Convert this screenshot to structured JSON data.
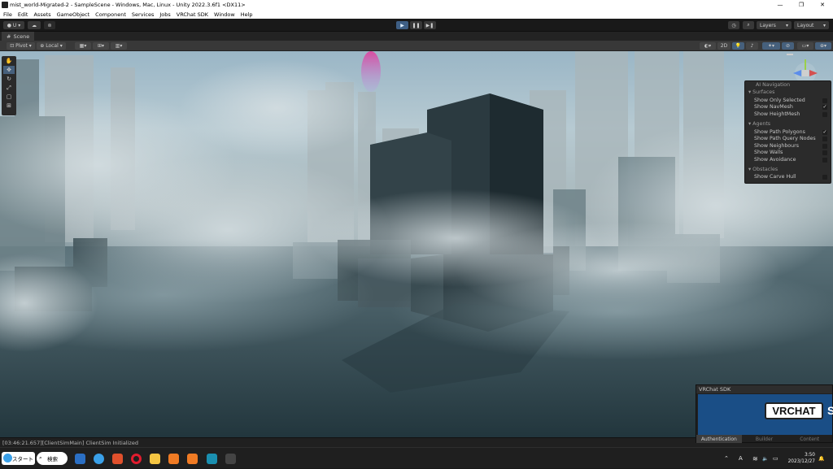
{
  "window": {
    "title": "mist_world-Migrated-2 - SampleScene - Windows, Mac, Linux - Unity 2022.3.6f1 <DX11>",
    "minimize_glyph": "—",
    "maximize_glyph": "❐",
    "close_glyph": "✕"
  },
  "menu": [
    "File",
    "Edit",
    "Assets",
    "GameObject",
    "Component",
    "Services",
    "Jobs",
    "VRChat SDK",
    "Window",
    "Help"
  ],
  "toolbar": {
    "account_label": "U",
    "play_glyph": "▶",
    "pause_glyph": "❚❚",
    "step_glyph": "▶❚",
    "layers_label": "Layers",
    "layout_label": "Layout"
  },
  "scene_tab": {
    "label": "Scene"
  },
  "scene_tools": {
    "pivot_label": "Pivot",
    "local_label": "Local",
    "mode_2d_label": "2D"
  },
  "nav_overlay": {
    "title": "AI Navigation",
    "sections": [
      {
        "label": "Surfaces"
      },
      {
        "label": "Agents"
      },
      {
        "label": "Obstacles"
      }
    ],
    "items": [
      {
        "label": "Show Only Selected",
        "checked": false
      },
      {
        "label": "Show NavMesh",
        "checked": true
      },
      {
        "label": "Show HeightMesh",
        "checked": false
      },
      {
        "label": "Show Path Polygons",
        "checked": true
      },
      {
        "label": "Show Path Query Nodes",
        "checked": false
      },
      {
        "label": "Show Neighbours",
        "checked": false
      },
      {
        "label": "Show Walls",
        "checked": false
      },
      {
        "label": "Show Avoidance",
        "checked": false
      },
      {
        "label": "Show Carve Hull",
        "checked": false
      }
    ],
    "check_glyph": "✓"
  },
  "console": {
    "message": "[03:46:21.657][ClientSimMain] ClientSim Initialized"
  },
  "vrchat_panel": {
    "title": "VRChat SDK",
    "logo_text": "VRCHAT",
    "logo_suffix": "S",
    "tabs": [
      "Authentication",
      "Builder",
      "Content"
    ],
    "active_tab": "Authentication"
  },
  "taskbar": {
    "start_label": "スタート",
    "search_label": "検索",
    "tray_input": "A",
    "clock_time": "3:50",
    "clock_date": "2023/12/27",
    "chevron_glyph": "⌃",
    "wifi_glyph": "≋",
    "volume_glyph": "🔈",
    "battery_glyph": "▭",
    "bell_glyph": "🔔"
  }
}
